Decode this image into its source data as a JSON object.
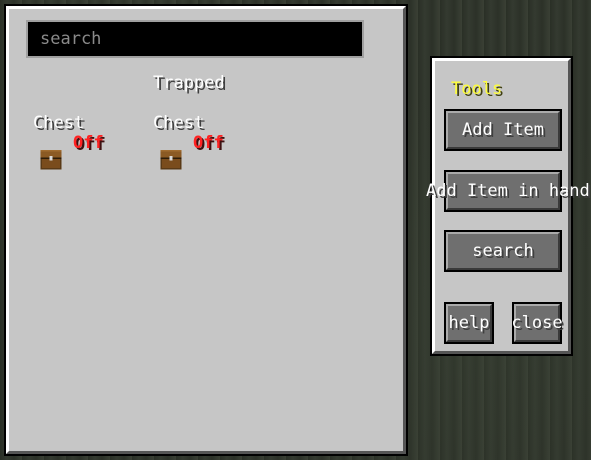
{
  "search": {
    "placeholder": "search"
  },
  "items": [
    {
      "name_line1": "",
      "name_line2": "Chest",
      "status": "Off",
      "icon": "chest-icon"
    },
    {
      "name_line1": "Trapped",
      "name_line2": "Chest",
      "status": "Off",
      "icon": "trapped-chest-icon"
    }
  ],
  "tools": {
    "title": "Tools",
    "add_item": "Add Item",
    "add_item_in_hand": "Add Item in hand",
    "search": "search",
    "help": "help",
    "close": "close"
  },
  "colors": {
    "panel": "#c6c6c6",
    "status_off": "#ff2222",
    "tools_title": "#ffff3a"
  }
}
